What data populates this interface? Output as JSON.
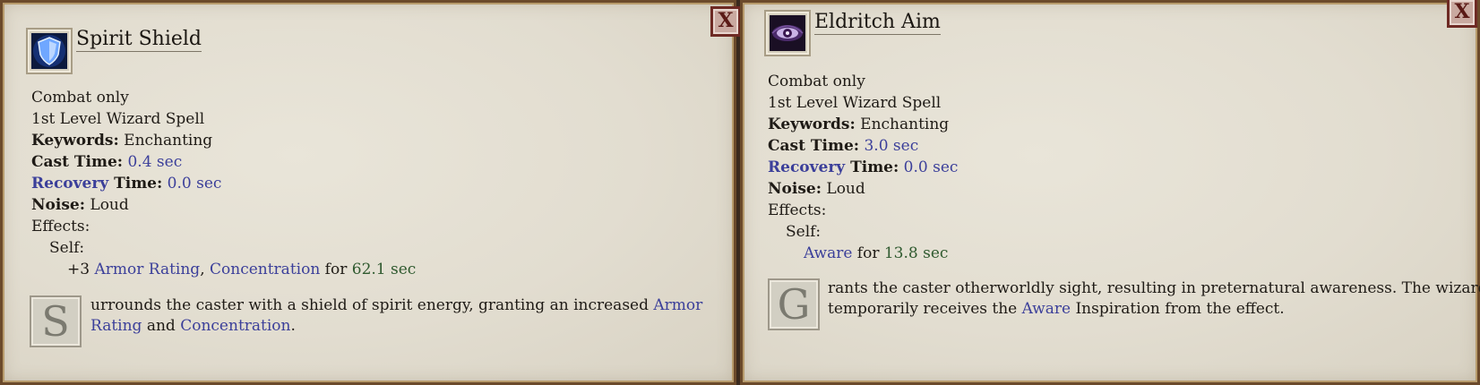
{
  "left": {
    "title": "Spirit Shield",
    "icon": "spirit-shield-icon",
    "line1": "Combat only",
    "line2": "1st Level Wizard Spell",
    "keywords_label": "Keywords:",
    "keywords_value": " Enchanting",
    "cast_label": "Cast Time:",
    "cast_value": " 0.4 sec",
    "recovery_word": "Recovery",
    "recovery_rest": " Time:",
    "recovery_value": " 0.0 sec",
    "noise_label": "Noise:",
    "noise_value": " Loud",
    "effects_label": "Effects:",
    "self_label": "Self:",
    "effect_prefix": "+3 ",
    "effect_link1": "Armor Rating",
    "effect_sep": ", ",
    "effect_link2": "Concentration",
    "effect_for": " for ",
    "effect_duration": "62.1 sec",
    "dropcap": "S",
    "desc_a": "urrounds the caster with a shield of spirit energy, granting an increased ",
    "desc_link1a": "Armor",
    "desc_link1b": "Rating",
    "desc_and": " and ",
    "desc_link2": "Concentration",
    "desc_end": "."
  },
  "right": {
    "title": "Eldritch Aim",
    "icon": "eldritch-eye-icon",
    "line1": "Combat only",
    "line2": "1st Level Wizard Spell",
    "keywords_label": "Keywords:",
    "keywords_value": " Enchanting",
    "cast_label": "Cast Time:",
    "cast_value": " 3.0 sec",
    "recovery_word": "Recovery",
    "recovery_rest": " Time:",
    "recovery_value": " 0.0 sec",
    "noise_label": "Noise:",
    "noise_value": " Loud",
    "effects_label": "Effects:",
    "self_label": "Self:",
    "effect_link": "Aware",
    "effect_for": " for ",
    "effect_duration": "13.8 sec",
    "dropcap": "G",
    "desc_a": "rants the caster otherworldly sight, resulting in preternatural awareness. The wizard",
    "desc_b1": "temporarily receives the ",
    "desc_link": "Aware",
    "desc_b2": " Inspiration from the effect."
  },
  "close_label": "X",
  "colors": {
    "link": "#3b3f9a",
    "duration": "#2f5a2f",
    "frame": "#6b4a2b"
  }
}
